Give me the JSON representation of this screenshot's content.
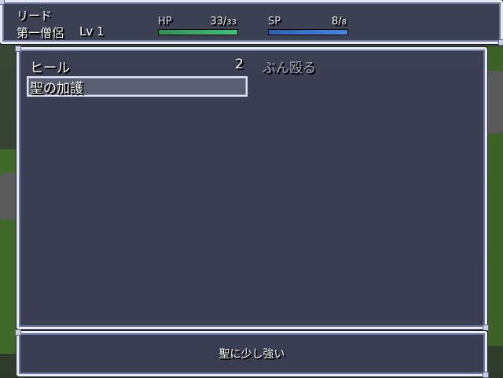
{
  "status": {
    "name": "リード",
    "class": "第一僧侶",
    "level_label": "Lv",
    "level": "1",
    "hp": {
      "label": "HP",
      "current": "33",
      "max": "33",
      "fill": 1.0,
      "color": "#3fc07a"
    },
    "sp": {
      "label": "SP",
      "current": "8",
      "max": "8",
      "fill": 1.0,
      "color": "#4a86dd"
    }
  },
  "skills": [
    {
      "name": "ヒール",
      "cost": "2",
      "enabled": true
    },
    {
      "name": "ぶん殴る",
      "cost": "",
      "enabled": false
    },
    {
      "name": "聖の加護",
      "cost": "",
      "enabled": true
    }
  ],
  "help": {
    "text": "聖に少し強い"
  }
}
